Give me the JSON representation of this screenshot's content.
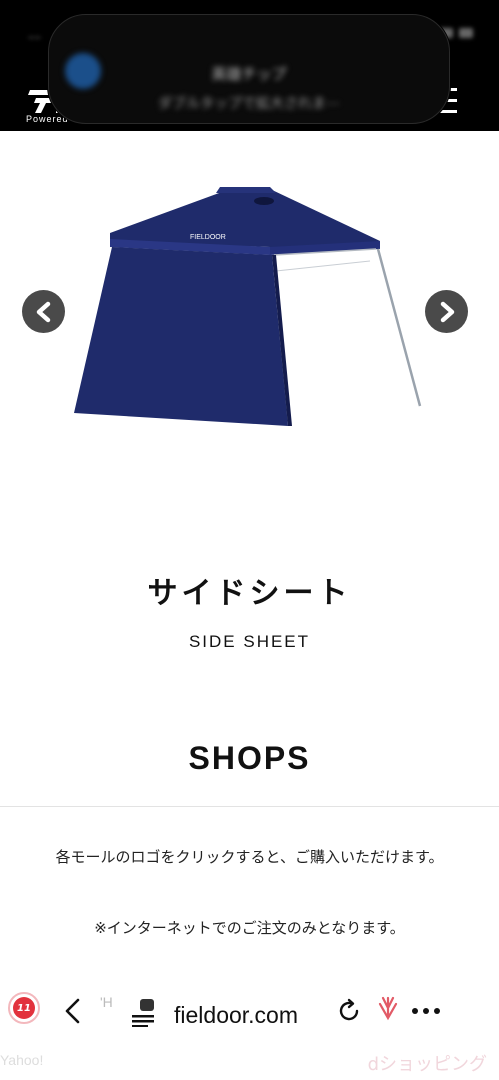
{
  "header": {
    "logo_text": "Powered by",
    "brand_mark": "FIELDOOR",
    "notification": {
      "title": "英雄チップ",
      "body": "ダブルタップで拡大されま⋯"
    }
  },
  "carousel": {
    "image_alt": "サイドシート",
    "prev_label": "‹",
    "next_label": "›"
  },
  "product": {
    "title": "サイドシート",
    "subtitle": "SIDE SHEET"
  },
  "shops": {
    "heading": "SHOPS",
    "description": "各モールのロゴをクリックすると、ご購入いただけます。",
    "note": "※インターネットでのご注文のみとなります。"
  },
  "browser": {
    "url": "fieldoor.com",
    "favicon_text": "11",
    "tab_hint": "'H",
    "faded_left": "Yahoo!",
    "faded_right": "dショッピング"
  },
  "colors": {
    "header_bg": "#000000",
    "arrow_bg": "#4a4a4a",
    "tent_navy": "#1f2b6b",
    "favicon_red": "#e2323d"
  }
}
